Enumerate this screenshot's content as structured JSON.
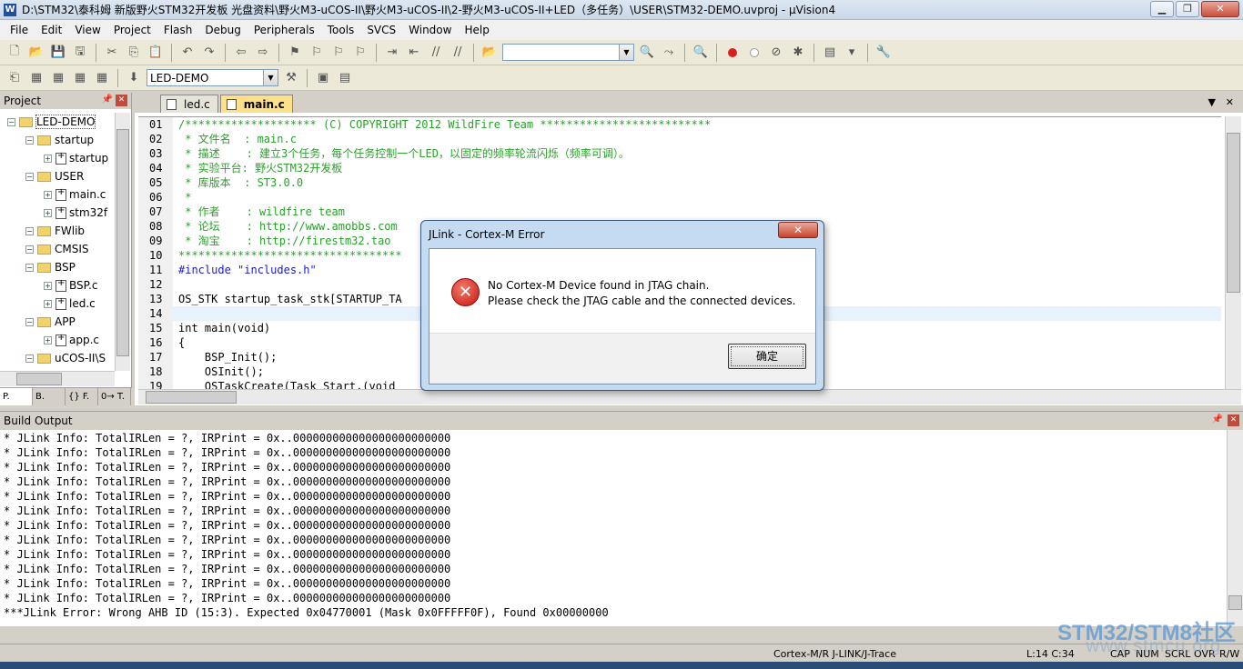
{
  "window": {
    "title": "D:\\STM32\\泰科姆 新版野火STM32开发板 光盘资料\\野火M3-uCOS-II\\野火M3-uCOS-II\\2-野火M3-uCOS-II+LED（多任务）\\USER\\STM32-DEMO.uvproj - µVision4"
  },
  "menu": [
    "File",
    "Edit",
    "View",
    "Project",
    "Flash",
    "Debug",
    "Peripherals",
    "Tools",
    "SVCS",
    "Window",
    "Help"
  ],
  "toolbar": {
    "find_value": "",
    "target": "LED-DEMO"
  },
  "project": {
    "title": "Project",
    "tree": [
      {
        "label": "LED-DEMO",
        "indent": 0,
        "kind": "root"
      },
      {
        "label": "startup",
        "indent": 1,
        "kind": "folder"
      },
      {
        "label": "startup",
        "indent": 2,
        "kind": "file"
      },
      {
        "label": "USER",
        "indent": 1,
        "kind": "folder"
      },
      {
        "label": "main.c",
        "indent": 2,
        "kind": "file"
      },
      {
        "label": "stm32f",
        "indent": 2,
        "kind": "file"
      },
      {
        "label": "FWlib",
        "indent": 1,
        "kind": "folder"
      },
      {
        "label": "CMSIS",
        "indent": 1,
        "kind": "folder"
      },
      {
        "label": "BSP",
        "indent": 1,
        "kind": "folder"
      },
      {
        "label": "BSP.c",
        "indent": 2,
        "kind": "file"
      },
      {
        "label": "led.c",
        "indent": 2,
        "kind": "file"
      },
      {
        "label": "APP",
        "indent": 1,
        "kind": "folder"
      },
      {
        "label": "app.c",
        "indent": 2,
        "kind": "file"
      },
      {
        "label": "uCOS-II\\S",
        "indent": 1,
        "kind": "folder"
      }
    ],
    "tabs": [
      "P.",
      "B.",
      "{} F.",
      "0→ T."
    ]
  },
  "editor": {
    "tabs": [
      "led.c",
      "main.c"
    ],
    "active_tab": "main.c",
    "lines": [
      {
        "n": "01",
        "text": "/******************** (C) COPYRIGHT 2012 WildFire Team **************************",
        "cls": "cmt"
      },
      {
        "n": "02",
        "text": " * 文件名  : main.c",
        "cls": "cmt"
      },
      {
        "n": "03",
        "text": " * 描述    : 建立3个任务，每个任务控制一个LED，以固定的频率轮流闪烁（频率可调）。",
        "cls": "cmt"
      },
      {
        "n": "04",
        "text": " * 实验平台: 野火STM32开发板",
        "cls": "cmt"
      },
      {
        "n": "05",
        "text": " * 库版本  : ST3.0.0",
        "cls": "cmt"
      },
      {
        "n": "06",
        "text": " *",
        "cls": "cmt"
      },
      {
        "n": "07",
        "text": " * 作者    : wildfire team",
        "cls": "cmt"
      },
      {
        "n": "08",
        "text": " * 论坛    : http://www.amobbs.com",
        "cls": "cmt"
      },
      {
        "n": "09",
        "text": " * 淘宝    : http://firestm32.tao",
        "cls": "cmt"
      },
      {
        "n": "10",
        "text": "**********************************",
        "cls": "cmt"
      },
      {
        "n": "11",
        "text": "#include \"includes.h\"",
        "cls": "kw"
      },
      {
        "n": "12",
        "text": "",
        "cls": ""
      },
      {
        "n": "13",
        "text": "OS_STK startup_task_stk[STARTUP_TA",
        "cls": ""
      },
      {
        "n": "14",
        "text": "",
        "cls": "curline"
      },
      {
        "n": "15",
        "text": "int main(void)",
        "cls": ""
      },
      {
        "n": "16",
        "text": "{",
        "cls": ""
      },
      {
        "n": "17",
        "text": "    BSP_Init();",
        "cls": ""
      },
      {
        "n": "18",
        "text": "    OSInit();",
        "cls": ""
      },
      {
        "n": "19",
        "text": "    OSTaskCreate(Task_Start,(void",
        "cls": ""
      }
    ]
  },
  "dialog": {
    "title": "JLink - Cortex-M Error",
    "close": "✕",
    "icon": "error-icon",
    "message_line1": "No Cortex-M Device found in JTAG chain.",
    "message_line2": "Please check the JTAG cable and the connected devices.",
    "ok_label": "确定"
  },
  "build_output": {
    "title": "Build Output",
    "lines": [
      "* JLink Info: TotalIRLen = ?, IRPrint = 0x..000000000000000000000000",
      "* JLink Info: TotalIRLen = ?, IRPrint = 0x..000000000000000000000000",
      "* JLink Info: TotalIRLen = ?, IRPrint = 0x..000000000000000000000000",
      "* JLink Info: TotalIRLen = ?, IRPrint = 0x..000000000000000000000000",
      "* JLink Info: TotalIRLen = ?, IRPrint = 0x..000000000000000000000000",
      "* JLink Info: TotalIRLen = ?, IRPrint = 0x..000000000000000000000000",
      "* JLink Info: TotalIRLen = ?, IRPrint = 0x..000000000000000000000000",
      "* JLink Info: TotalIRLen = ?, IRPrint = 0x..000000000000000000000000",
      "* JLink Info: TotalIRLen = ?, IRPrint = 0x..000000000000000000000000",
      "* JLink Info: TotalIRLen = ?, IRPrint = 0x..000000000000000000000000",
      "* JLink Info: TotalIRLen = ?, IRPrint = 0x..000000000000000000000000",
      "* JLink Info: TotalIRLen = ?, IRPrint = 0x..000000000000000000000000",
      "***JLink Error: Wrong AHB ID (15:3). Expected 0x04770001 (Mask 0x0FFFFF0F), Found 0x00000000"
    ]
  },
  "status": {
    "debugger": "Cortex-M/R J-LINK/J-Trace",
    "position": "L:14 C:34",
    "caps": "CAP",
    "num": "NUM",
    "scrl": "SCRL",
    "ovr": "OVR",
    "rw": "R/W"
  },
  "watermark": {
    "brand": "STM32/STM8社区",
    "url": "www.stmcu.org"
  },
  "colors": {
    "comment": "#2aa02a",
    "keyword": "#1a1acc",
    "active_tab": "#fce08a",
    "error_red": "#c8150e"
  }
}
